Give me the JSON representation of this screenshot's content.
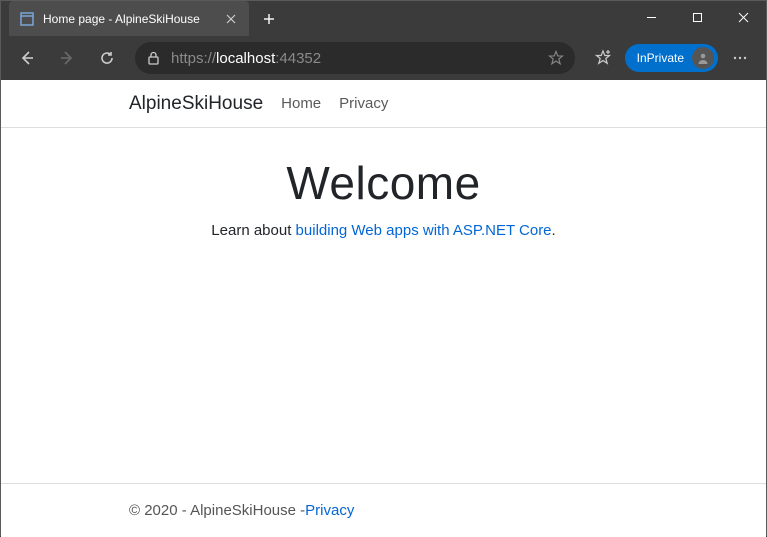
{
  "browser": {
    "tab_title": "Home page - AlpineSkiHouse",
    "url_proto": "https://",
    "url_host": "localhost",
    "url_port": ":44352",
    "inprivate_label": "InPrivate"
  },
  "nav": {
    "brand": "AlpineSkiHouse",
    "links": [
      "Home",
      "Privacy"
    ]
  },
  "hero": {
    "heading": "Welcome",
    "lead_prefix": "Learn about ",
    "lead_link": "building Web apps with ASP.NET Core",
    "lead_suffix": "."
  },
  "footer": {
    "text": "© 2020 - AlpineSkiHouse - ",
    "privacy": "Privacy"
  }
}
